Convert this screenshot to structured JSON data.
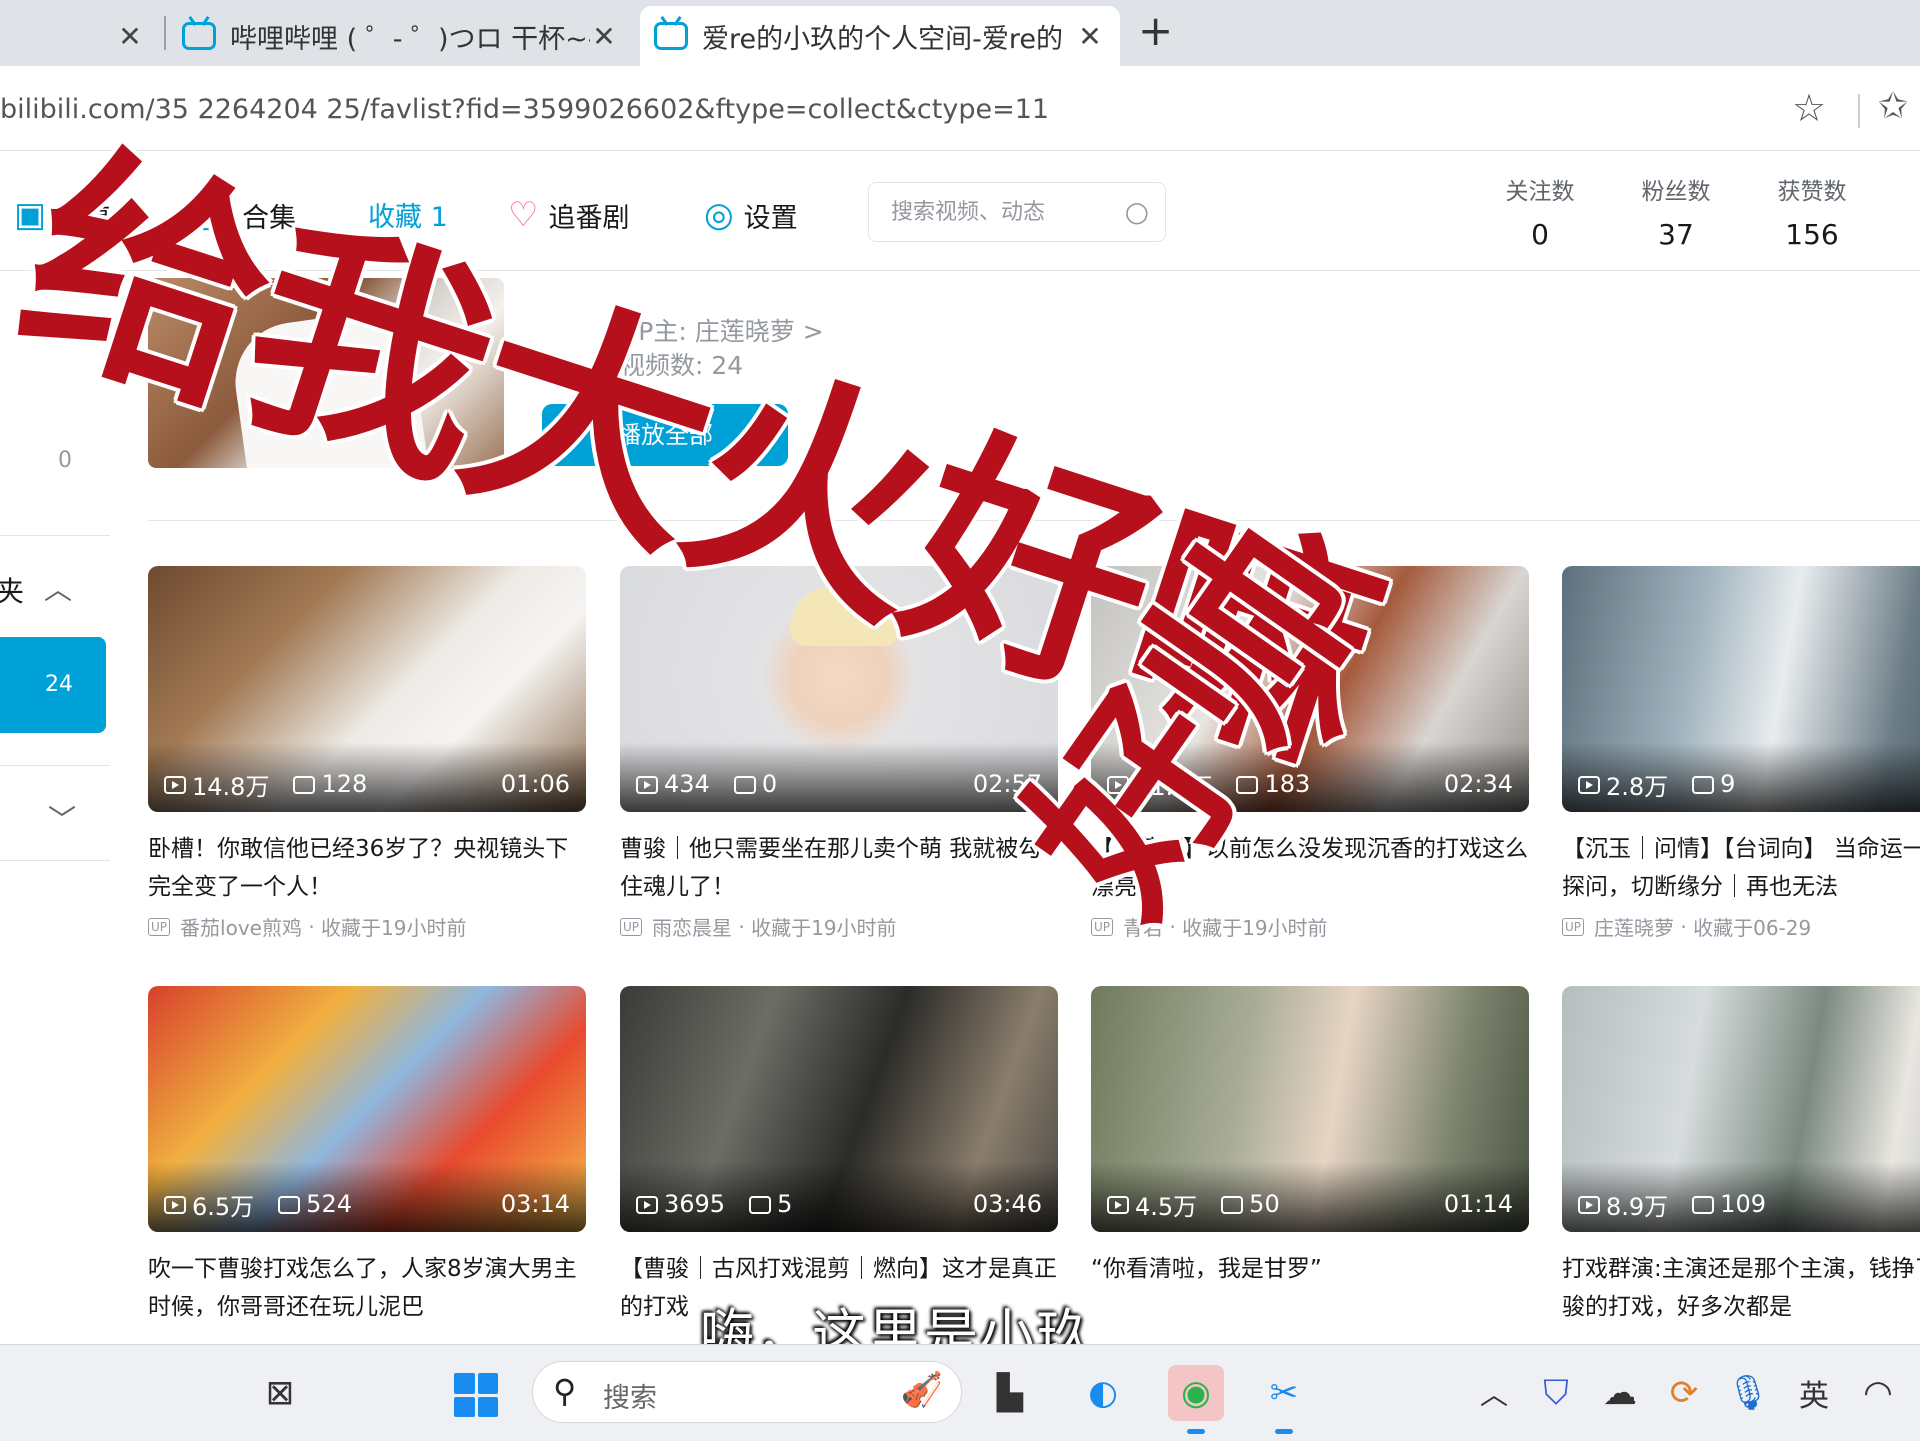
{
  "tabs": [
    {
      "title": "",
      "active": false
    },
    {
      "title": "哔哩哔哩 ( ゜- ゜)つロ 干杯~-bilibili",
      "active": false
    },
    {
      "title": "爱re的小玖的个人空间-爱re的小玖",
      "active": true
    }
  ],
  "address": {
    "url": "bilibili.com/35  2264204  25/favlist?fid=3599026602&ftype=collect&ctype=11"
  },
  "nav": {
    "items": [
      {
        "label": "投稿"
      },
      {
        "label": "合集"
      },
      {
        "label": "收藏 1"
      },
      {
        "label": "追番剧"
      },
      {
        "label": "设置"
      }
    ],
    "search_placeholder": "搜索视频、动态"
  },
  "stats": [
    {
      "label": "关注数",
      "value": "0"
    },
    {
      "label": "粉丝数",
      "value": "37"
    },
    {
      "label": "获赞数",
      "value": "156"
    }
  ],
  "sidebar": {
    "zero": "0",
    "folder_label": "夹",
    "active_count": "24"
  },
  "collection": {
    "up_text": "UP主: 庄莲晓萝 >",
    "count_text": "视频数: 24",
    "play_all": "播放全部"
  },
  "videos": [
    {
      "views": "14.8万",
      "danmaku": "128",
      "duration": "01:06",
      "title": "卧槽！你敢信他已经36岁了？央视镜头下完全变了一个人！",
      "uploader": "番茄love煎鸡",
      "saved": "收藏于19小时前"
    },
    {
      "views": "434",
      "danmaku": "0",
      "duration": "02:57",
      "title": "曹骏｜他只需要坐在那儿卖个萌 我就被勾住魂儿了！",
      "uploader": "雨恋晨星",
      "saved": "收藏于19小时前"
    },
    {
      "views": "11.8万",
      "danmaku": "183",
      "duration": "02:34",
      "title": "【宝莲灯】以前怎么没发现沉香的打戏这么漂亮",
      "uploader": "青若",
      "saved": "收藏于19小时前"
    },
    {
      "views": "2.8万",
      "danmaku": "9",
      "duration": "",
      "title": "【沉玉｜问情】【台词向】 当命运一句一句探问，切断缘分｜再也无法",
      "uploader": "庄莲晓萝",
      "saved": "收藏于06-29"
    },
    {
      "views": "6.5万",
      "danmaku": "524",
      "duration": "03:14",
      "title": "吹一下曹骏打戏怎么了，人家8岁演大男主时候，你哥哥还在玩儿泥巴",
      "uploader": "",
      "saved": ""
    },
    {
      "views": "3695",
      "danmaku": "5",
      "duration": "03:46",
      "title": "【曹骏｜古风打戏混剪｜燃向】这才是真正的打戏",
      "uploader": "",
      "saved": ""
    },
    {
      "views": "4.5万",
      "danmaku": "50",
      "duration": "01:14",
      "title": "“你看清啦，我是甘罗”",
      "uploader": "",
      "saved": ""
    },
    {
      "views": "8.9万",
      "danmaku": "109",
      "duration": "",
      "title": "打戏群演:主演还是那个主演，钱挣了！曹骏的打戏，好多次都是",
      "uploader": "",
      "saved": ""
    }
  ],
  "overlay": {
    "line1": "给我大火好嘛",
    "line2": "好帅",
    "subtitle": "嗨，这里是小玖"
  },
  "taskbar": {
    "search_placeholder": "搜索",
    "ime": "英"
  },
  "colors": {
    "brand": "#00a1d6",
    "overlay_red": "#b5101c"
  },
  "icons": [
    "bilibili-tab-icon",
    "close-icon",
    "plus-icon",
    "star-icon",
    "favorites-icon",
    "upload-icon",
    "collection-icon",
    "heart-icon",
    "settings-icon",
    "search-icon",
    "play-icon",
    "danmaku-icon",
    "windows-logo",
    "edge-icon",
    "wechat-icon",
    "shield-icon",
    "wifi-icon",
    "mic-icon"
  ]
}
